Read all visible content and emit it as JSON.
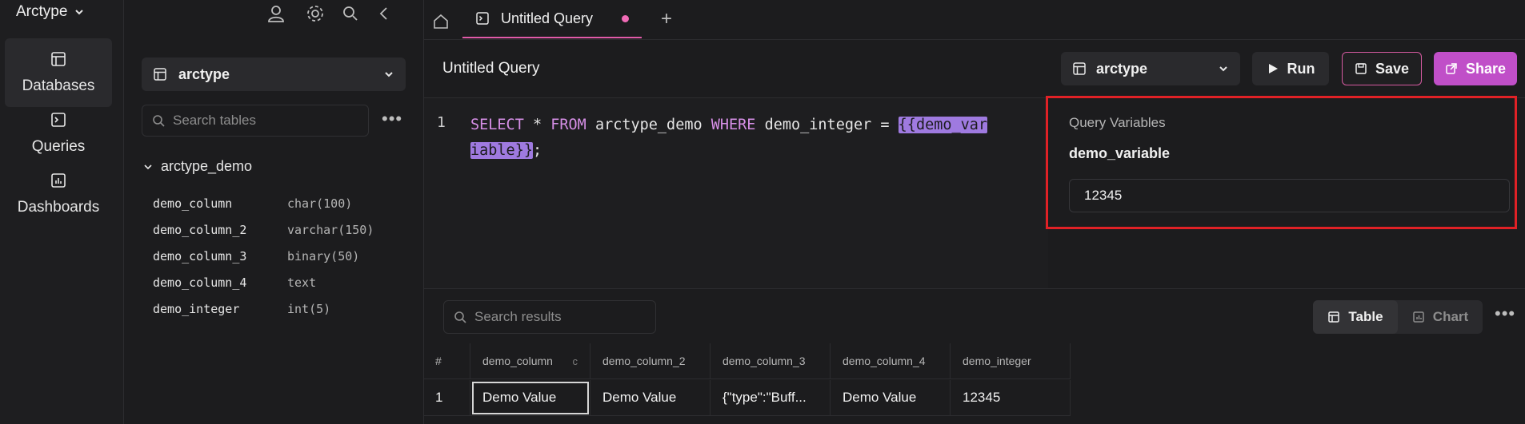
{
  "app": {
    "title": "Arctype"
  },
  "rail": {
    "items": [
      {
        "label": "Databases",
        "icon": "table-icon",
        "active": true
      },
      {
        "label": "Queries",
        "icon": "terminal-icon",
        "active": false
      },
      {
        "label": "Dashboards",
        "icon": "chart-icon",
        "active": false
      }
    ]
  },
  "explorer": {
    "db_name": "arctype",
    "search_placeholder": "Search tables",
    "table_name": "arctype_demo",
    "columns": [
      {
        "name": "demo_column",
        "type": "char(100)"
      },
      {
        "name": "demo_column_2",
        "type": "varchar(150)"
      },
      {
        "name": "demo_column_3",
        "type": "binary(50)"
      },
      {
        "name": "demo_column_4",
        "type": "text"
      },
      {
        "name": "demo_integer",
        "type": "int(5)"
      }
    ]
  },
  "tabs": {
    "query_tab_label": "Untitled Query",
    "add_label": "+"
  },
  "toolbar": {
    "query_title": "Untitled Query",
    "db_name": "arctype",
    "run_label": "Run",
    "save_label": "Save",
    "share_label": "Share"
  },
  "editor": {
    "line_number": "1",
    "kw_select": "SELECT",
    "star": " * ",
    "kw_from": "FROM",
    "table": " arctype_demo ",
    "kw_where": "WHERE",
    "cond": " demo_integer = ",
    "var_part1": "{{demo_var",
    "var_part2": "iable}}",
    "semicolon": ";"
  },
  "variables": {
    "title": "Query Variables",
    "name": "demo_variable",
    "value": "12345"
  },
  "results": {
    "search_placeholder": "Search results",
    "table_label": "Table",
    "chart_label": "Chart",
    "headers": [
      "#",
      "demo_column",
      "demo_column_2",
      "demo_column_3",
      "demo_column_4",
      "demo_integer"
    ],
    "sort_mark": "c",
    "rows": [
      [
        "1",
        "Demo Value",
        "Demo Value",
        "{\"type\":\"Buff...",
        "Demo Value",
        "12345"
      ]
    ]
  },
  "colors": {
    "accent_pink": "#e05aa8",
    "share_purple": "#c04fc8",
    "keyword": "#d68fe6",
    "variable_highlight": "#9f7ae0",
    "annotation_red": "#e02126"
  }
}
